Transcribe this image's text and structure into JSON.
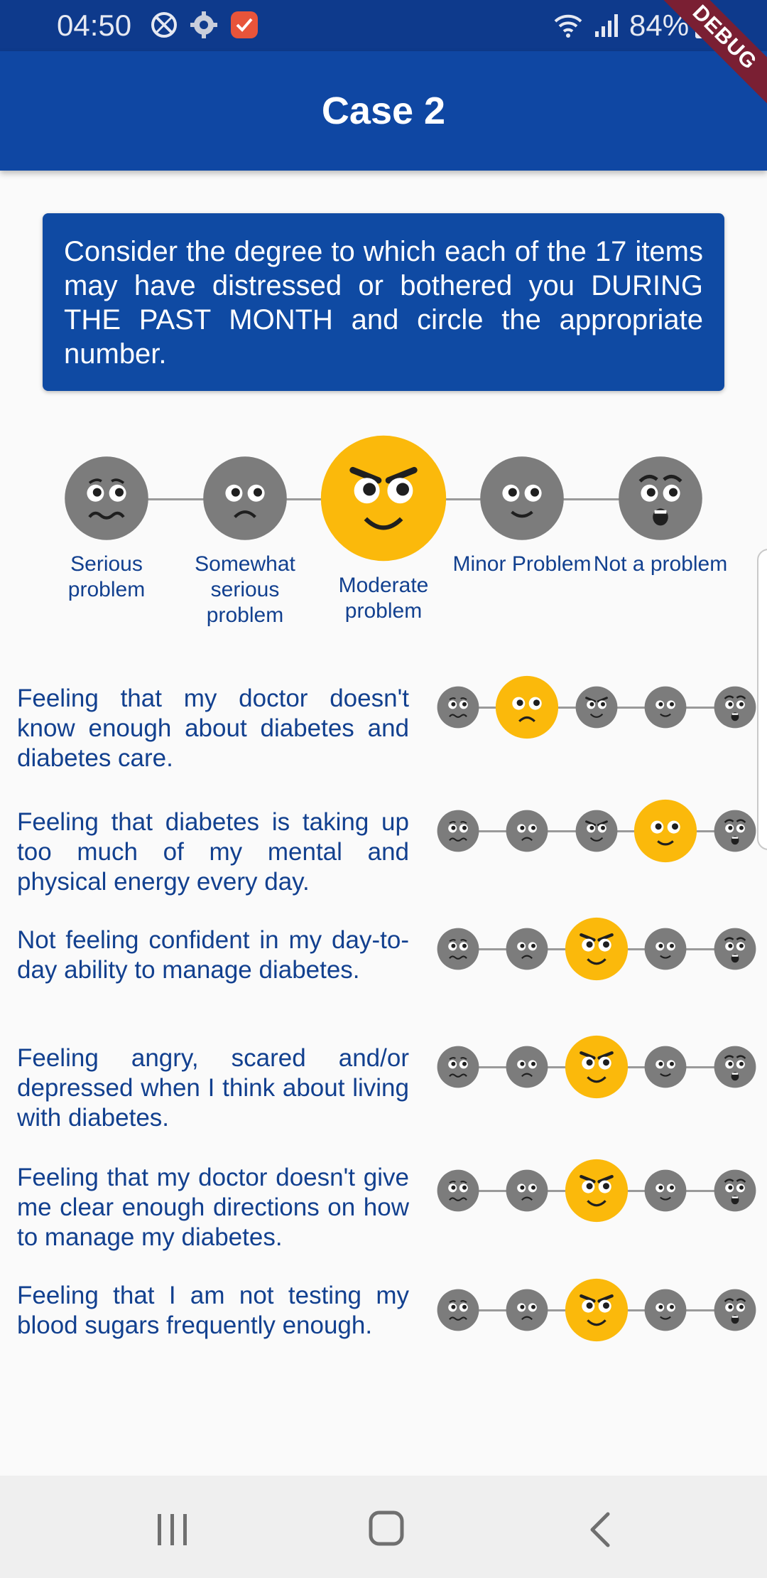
{
  "status_bar": {
    "time": "04:50",
    "battery": "84%",
    "debug_label": "DEBUG"
  },
  "app_bar": {
    "title": "Case 2"
  },
  "instruction": "Consider the degree to which each of the 17 items may have distressed or bothered you DURING THE PAST MONTH and circle the appropriate number.",
  "scale": {
    "options": [
      "Serious problem",
      "Somewhat serious problem",
      "Moderate problem",
      "Minor Problem",
      "Not a problem"
    ],
    "legend_selected_index": 2,
    "colors": {
      "selected": "#fbb90b",
      "unselected": "#7c7c7c",
      "text": "#12408f"
    }
  },
  "questions": [
    {
      "text": "Feeling that my doctor doesn't know enough about diabetes and diabetes care.",
      "selected_index": 1
    },
    {
      "text": "Feeling that diabetes is taking up too much of my mental and physical energy every day.",
      "selected_index": 3
    },
    {
      "text": "Not feeling confident in my day-to-day ability to manage diabetes.",
      "selected_index": 2
    },
    {
      "text": "Feeling angry, scared and/or depressed when I think about living with diabetes.",
      "selected_index": 2
    },
    {
      "text": "Feeling that my doctor doesn't give me clear enough directions on how to manage my diabetes.",
      "selected_index": 2
    },
    {
      "text": "Feeling that I am not testing my blood sugars frequently enough.",
      "selected_index": 2
    }
  ],
  "nav_bar": {
    "buttons": [
      "recent-apps",
      "home",
      "back"
    ]
  }
}
